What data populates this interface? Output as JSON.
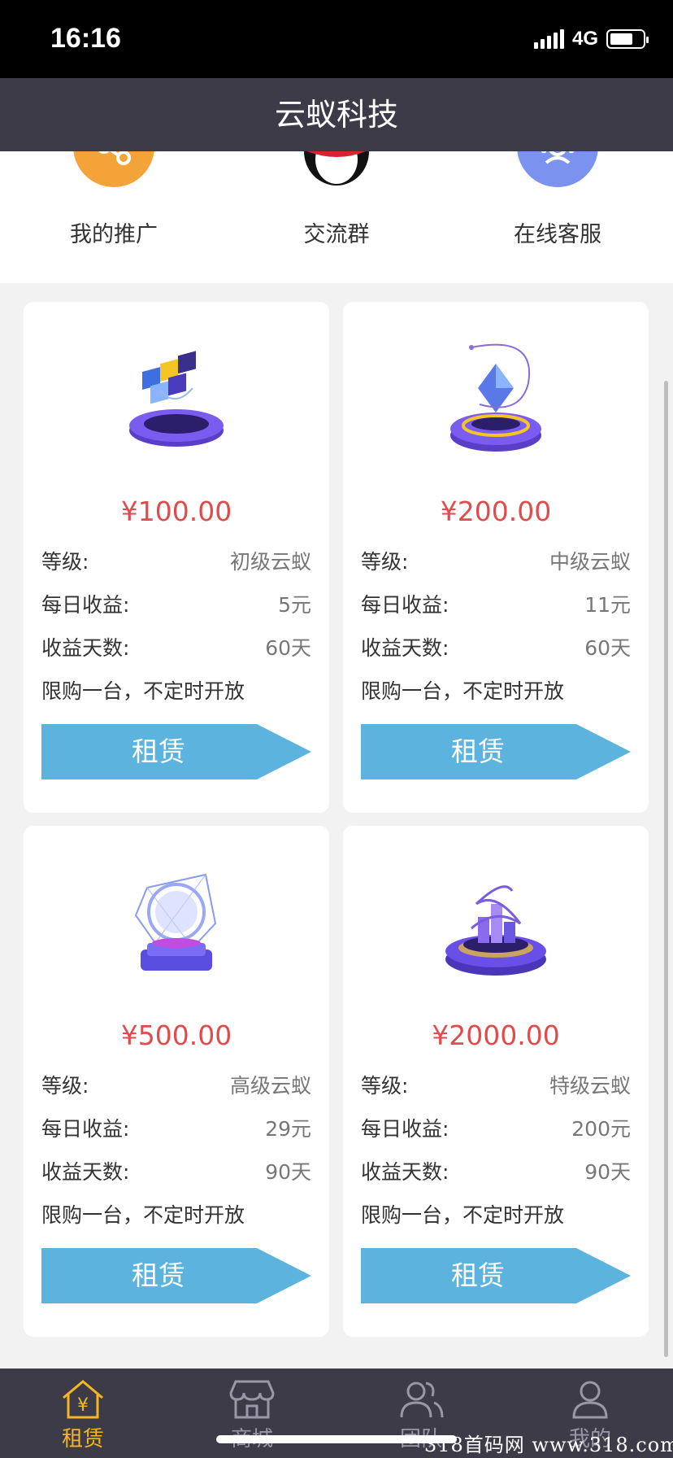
{
  "status": {
    "time": "16:16",
    "network": "4G",
    "battery_level": 0.7
  },
  "header": {
    "title": "云蚁科技"
  },
  "quick_links": [
    {
      "label": "我的推广",
      "icon": "share-icon",
      "color": "#f4a338"
    },
    {
      "label": "交流群",
      "icon": "penguin-icon",
      "color": "#ffffff"
    },
    {
      "label": "在线客服",
      "icon": "customer-service-icon",
      "color": "#7b93ee"
    }
  ],
  "products": [
    {
      "price": "¥100.00",
      "level_label": "等级:",
      "level": "初级云蚁",
      "daily_label": "每日收益:",
      "daily": "5元",
      "days_label": "收益天数:",
      "days": "60天",
      "note": "限购一台，不定时开放",
      "button": "租赁"
    },
    {
      "price": "¥200.00",
      "level_label": "等级:",
      "level": "中级云蚁",
      "daily_label": "每日收益:",
      "daily": "11元",
      "days_label": "收益天数:",
      "days": "60天",
      "note": "限购一台，不定时开放",
      "button": "租赁"
    },
    {
      "price": "¥500.00",
      "level_label": "等级:",
      "level": "高级云蚁",
      "daily_label": "每日收益:",
      "daily": "29元",
      "days_label": "收益天数:",
      "days": "90天",
      "note": "限购一台，不定时开放",
      "button": "租赁"
    },
    {
      "price": "¥2000.00",
      "level_label": "等级:",
      "level": "特级云蚁",
      "daily_label": "每日收益:",
      "daily": "200元",
      "days_label": "收益天数:",
      "days": "90天",
      "note": "限购一台，不定时开放",
      "button": "租赁"
    }
  ],
  "tabs": [
    {
      "label": "租赁",
      "icon": "rent-home-icon",
      "active": true
    },
    {
      "label": "商城",
      "icon": "store-icon",
      "active": false
    },
    {
      "label": "团队",
      "icon": "team-icon",
      "active": false
    },
    {
      "label": "我的",
      "icon": "profile-icon",
      "active": false
    }
  ],
  "watermark": "318首码网 www.318.com",
  "colors": {
    "accent": "#f5b623",
    "price": "#e24b4b",
    "button": "#5bb3de",
    "header": "#3d3b47"
  }
}
